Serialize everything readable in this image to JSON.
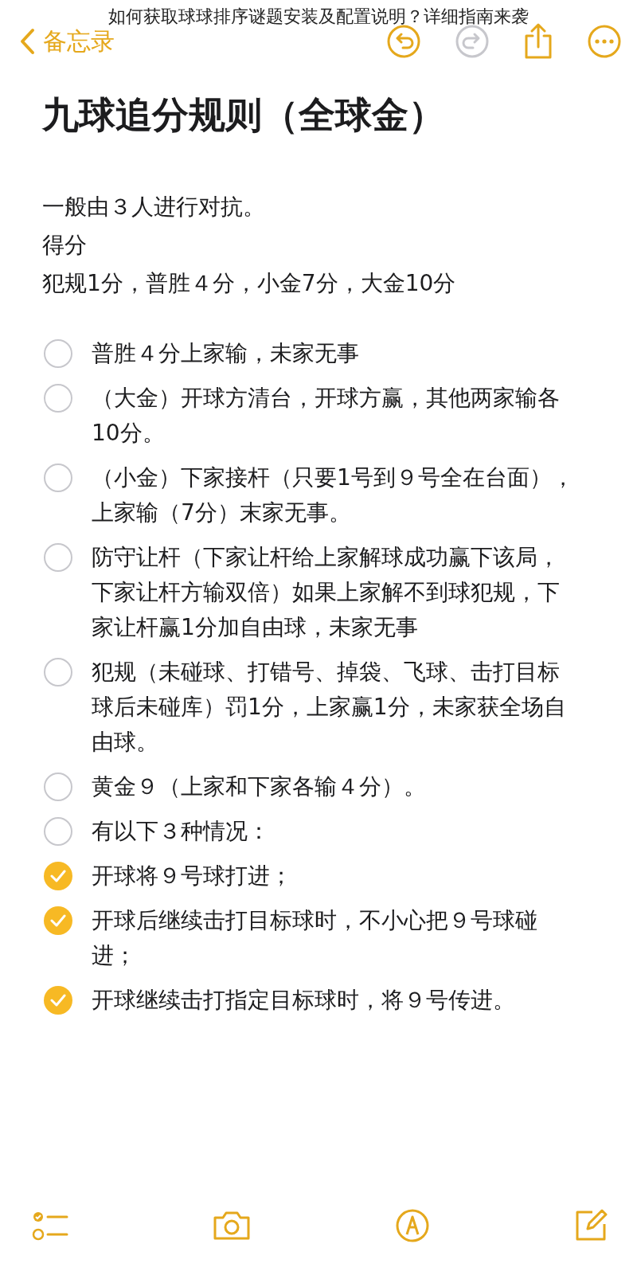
{
  "caption": "如何获取球球排序谜题安装及配置说明？详细指南来袭",
  "nav": {
    "back_label": "备忘录"
  },
  "note": {
    "title": "九球追分规则（全球金）",
    "lines": [
      "一般由３人进行对抗。",
      "得分",
      "犯规1分，普胜４分，小金7分，大金10分"
    ],
    "checklist": [
      {
        "text": "普胜４分上家输，未家无事",
        "checked": false
      },
      {
        "text": "（大金）开球方清台，开球方赢，其他两家输各10分。",
        "checked": false
      },
      {
        "text": "（小金）下家接杆（只要1号到９号全在台面），上家输（7分）末家无事。",
        "checked": false
      },
      {
        "text": "防守让杆（下家让杆给上家解球成功赢下该局，下家让杆方输双倍）如果上家解不到球犯规，下家让杆赢1分加自由球，未家无事",
        "checked": false
      },
      {
        "text": "犯规（未碰球、打错号、掉袋、飞球、击打目标球后未碰库）罚1分，上家赢1分，未家获全场自由球。",
        "checked": false
      },
      {
        "text": "黄金９（上家和下家各输４分）。",
        "checked": false
      },
      {
        "text": "有以下３种情况：",
        "checked": false
      },
      {
        "text": "开球将９号球打进；",
        "checked": true
      },
      {
        "text": "开球后继续击打目标球时，不小心把９号球碰进；",
        "checked": true
      },
      {
        "text": "开球继续击打指定目标球时，将９号传进。",
        "checked": true
      }
    ]
  }
}
